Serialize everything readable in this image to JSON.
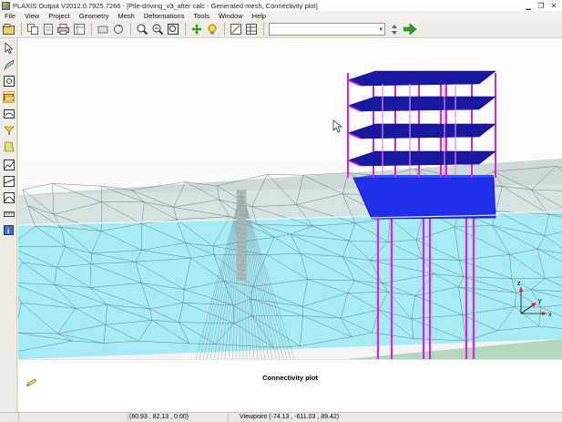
{
  "window": {
    "title": "PLAXIS Output V2012.0.7925.7266 - [Pile-driving_v3_after calc - Generated mesh, Connectivity plot]",
    "controls": [
      "minimize-icon",
      "restore-icon",
      "close-icon"
    ]
  },
  "menubar": [
    "File",
    "View",
    "Project",
    "Geometry",
    "Mesh",
    "Deformations",
    "Tools",
    "Window",
    "Help"
  ],
  "toolbar": {
    "icons": [
      "open-project-icon",
      "copy-icon",
      "export-icon",
      "print-icon",
      "table-icon",
      "settings-icon",
      "zoom-in-icon",
      "zoom-out-icon",
      "zoom-extents-icon",
      "rotate-icon",
      "light-icon",
      "resize-icon",
      "table-view-icon",
      "list-icon"
    ],
    "combo_value": "",
    "go_icon": "green-arrow-icon"
  },
  "left_tools": [
    "select-icon",
    "draw-icon",
    "node-icon",
    "folder-icon",
    "curve-icon",
    "pen-icon",
    "cross-section-icon",
    "chart-icon",
    "cut-plane-icon",
    "graph-icon",
    "info-icon"
  ],
  "viewport": {
    "plot_title": "Connectivity plot",
    "axes": {
      "z": "z",
      "y": "y",
      "x": "x"
    }
  },
  "status": {
    "coordinates": "(60.93 , 82.13 , 0.00)",
    "viewpoint": "Viewpoint (-74.13 , -611.03 , 89.42)"
  },
  "colors": {
    "soil_upper": "#cfe0e0",
    "soil_lower": "#a8e8f0",
    "ground_green": "#b8dcc0",
    "mesh_line": "#5a6a70",
    "building_slab": "#1818a0",
    "building_column": "#e020e0",
    "foundation": "#2030e8"
  }
}
